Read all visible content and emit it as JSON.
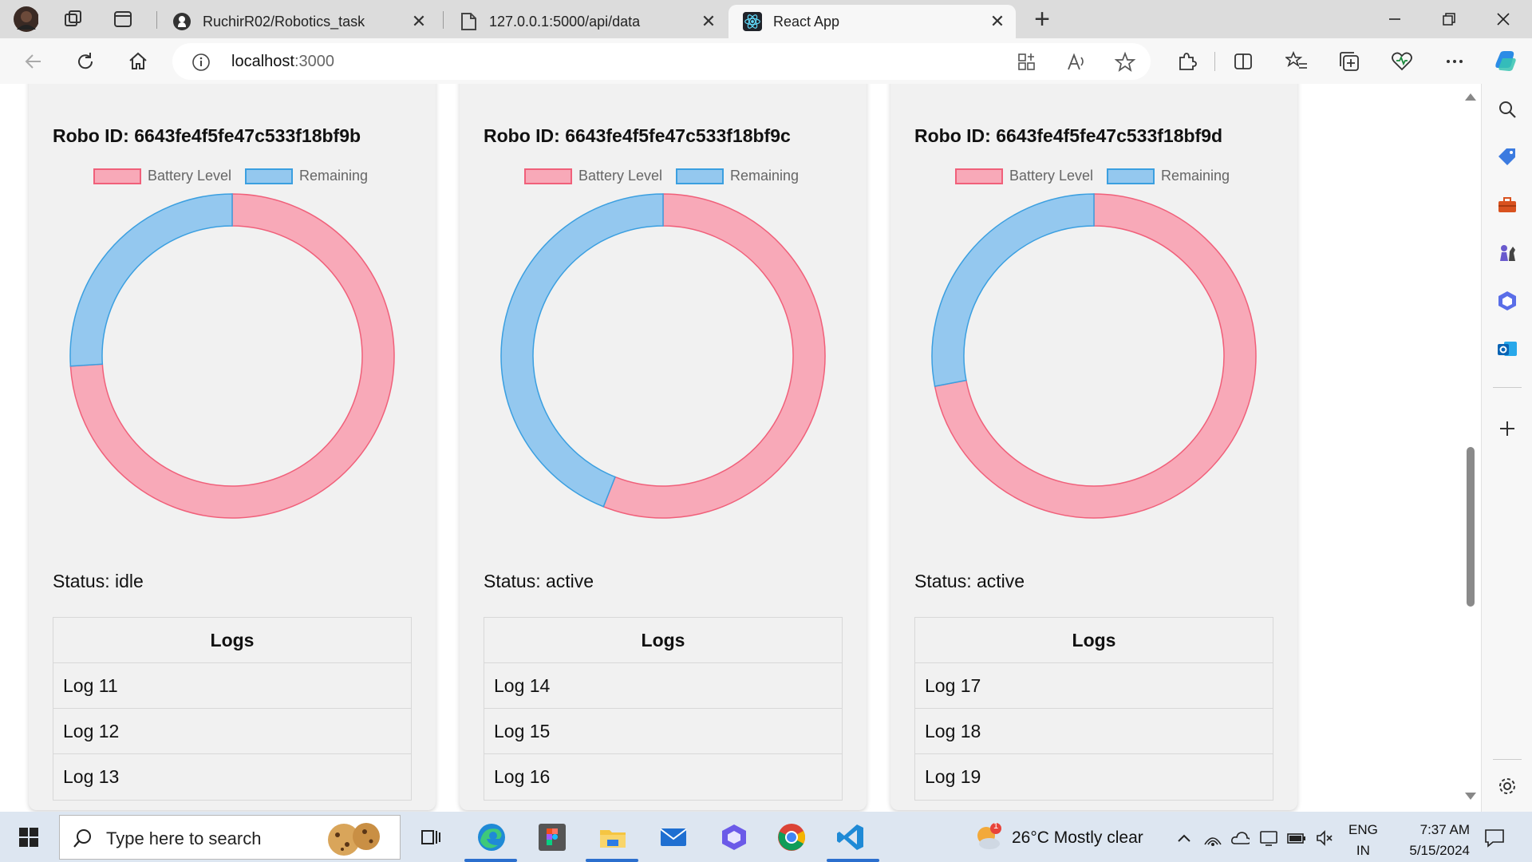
{
  "browser": {
    "tabs": [
      {
        "title": "RuchirR02/Robotics_task",
        "icon": "github-icon",
        "active": false
      },
      {
        "title": "127.0.0.1:5000/api/data",
        "icon": "page-icon",
        "active": false
      },
      {
        "title": "React App",
        "icon": "react-icon",
        "active": true
      }
    ],
    "new_tab_label": "+",
    "close_glyph": "✕",
    "address": {
      "host": "localhost",
      "port": ":3000"
    }
  },
  "legend": {
    "battery_label": "Battery Level",
    "remaining_label": "Remaining"
  },
  "colors": {
    "battery_fill": "#f8a9b8",
    "battery_stroke": "#f0607a",
    "remaining_fill": "#94c8ef",
    "remaining_stroke": "#3b9fe0",
    "card_bg": "#f1f1f1"
  },
  "robots": [
    {
      "title": "Robo ID: 6643fe4f5fe47c533f18bf9b",
      "battery_level": 74,
      "remaining": 26,
      "status": "Status: idle",
      "logs_header": "Logs",
      "logs": [
        "Log 11",
        "Log 12",
        "Log 13"
      ]
    },
    {
      "title": "Robo ID: 6643fe4f5fe47c533f18bf9c",
      "battery_level": 56,
      "remaining": 44,
      "status": "Status: active",
      "logs_header": "Logs",
      "logs": [
        "Log 14",
        "Log 15",
        "Log 16"
      ]
    },
    {
      "title": "Robo ID: 6643fe4f5fe47c533f18bf9d",
      "battery_level": 72,
      "remaining": 28,
      "status": "Status: active",
      "logs_header": "Logs",
      "logs": [
        "Log 17",
        "Log 18",
        "Log 19"
      ]
    }
  ],
  "chart_data": [
    {
      "type": "pie",
      "categories": [
        "Battery Level",
        "Remaining"
      ],
      "values": [
        74,
        26
      ],
      "title": ""
    },
    {
      "type": "pie",
      "categories": [
        "Battery Level",
        "Remaining"
      ],
      "values": [
        56,
        44
      ],
      "title": ""
    },
    {
      "type": "pie",
      "categories": [
        "Battery Level",
        "Remaining"
      ],
      "values": [
        72,
        28
      ],
      "title": ""
    }
  ],
  "taskbar": {
    "search_placeholder": "Type here to search",
    "weather": "26°C  Mostly clear",
    "weather_badge": "1",
    "lang_line1": "ENG",
    "lang_line2": "IN",
    "time": "7:37 AM",
    "date": "5/15/2024"
  }
}
